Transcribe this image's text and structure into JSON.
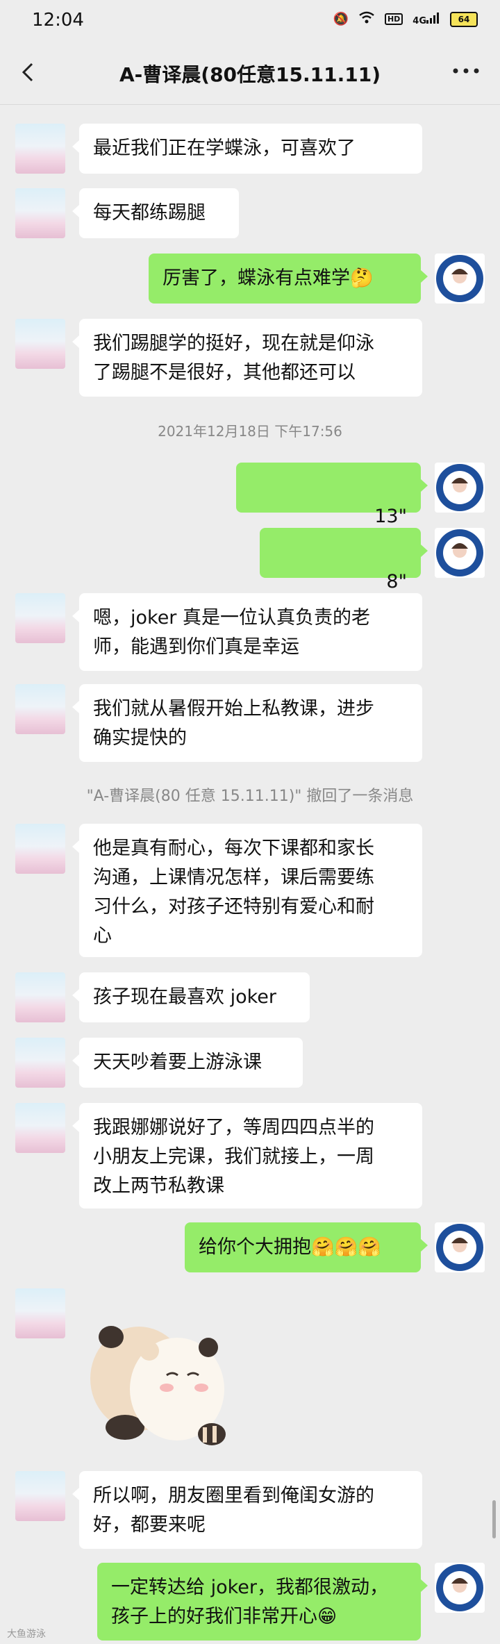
{
  "status_bar": {
    "time": "12:04",
    "network": "4G",
    "battery": "64"
  },
  "header": {
    "title": "A-曹译晨(80任意15.11.11)"
  },
  "messages": [
    {
      "text": "最近我们正在学蝶泳，可喜欢了"
    },
    {
      "text": "每天都练踢腿"
    },
    {
      "text": "厉害了，蝶泳有点难学🤔"
    },
    {
      "text": "我们踢腿学的挺好，现在就是仰泳\n了踢腿不是很好，其他都还可以"
    },
    {
      "timestamp": "2021年12月18日 下午17:56"
    },
    {
      "voice": "13\""
    },
    {
      "voice": "8\""
    },
    {
      "text": "嗯，joker 真是一位认真负责的老\n师，能遇到你们真是幸运"
    },
    {
      "text": "我们就从暑假开始上私教课，进步\n确实提快的"
    },
    {
      "system": "\"A-曹译晨(80 任意 15.11.11)\" 撤回了一条消息"
    },
    {
      "text": "他是真有耐心，每次下课都和家长\n沟通，上课情况怎样，课后需要练\n习什么，对孩子还特别有爱心和耐\n心"
    },
    {
      "text": "孩子现在最喜欢 joker"
    },
    {
      "text": "天天吵着要上游泳课"
    },
    {
      "text": "我跟娜娜说好了，等周四四点半的\n小朋友上完课，我们就接上，一周\n改上两节私教课"
    },
    {
      "text": "给你个大拥抱🤗🤗🤗"
    },
    {
      "sticker": "panda-hug-sticker"
    },
    {
      "text": "所以啊，朋友圈里看到俺闺女游的\n好，都要来呢"
    },
    {
      "text": "一定转达给 joker，我都很激动，\n孩子上的好我们非常开心😁"
    }
  ],
  "colors": {
    "background": "#ededed",
    "outgoing_bubble": "#95ec69",
    "incoming_bubble": "#ffffff"
  },
  "watermark": "大鱼游泳"
}
